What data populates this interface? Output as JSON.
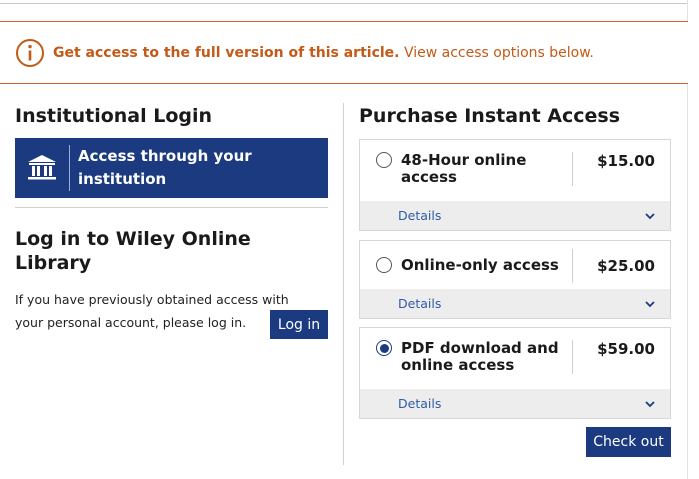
{
  "banner": {
    "strong_text": "Get access to the full version of this article.",
    "link_text": "View access options below."
  },
  "left": {
    "institutional_title": "Institutional Login",
    "institution_button": "Access through your institution",
    "login_title": "Log in to Wiley Online Library",
    "login_desc": "If you have previously obtained access with your personal account, please log in.",
    "login_button": "Log in"
  },
  "right": {
    "title": "Purchase Instant Access",
    "options": [
      {
        "label": "48-Hour online access",
        "price": "$15.00",
        "details": "Details",
        "selected": false
      },
      {
        "label": "Online-only access",
        "price": "$25.00",
        "details": "Details",
        "selected": false
      },
      {
        "label": "PDF download and online access",
        "price": "$59.00",
        "details": "Details",
        "selected": true
      }
    ],
    "checkout_button": "Check out"
  },
  "colors": {
    "accent": "#1b3a80",
    "banner": "#c35a18",
    "link": "#2f5aa8"
  }
}
